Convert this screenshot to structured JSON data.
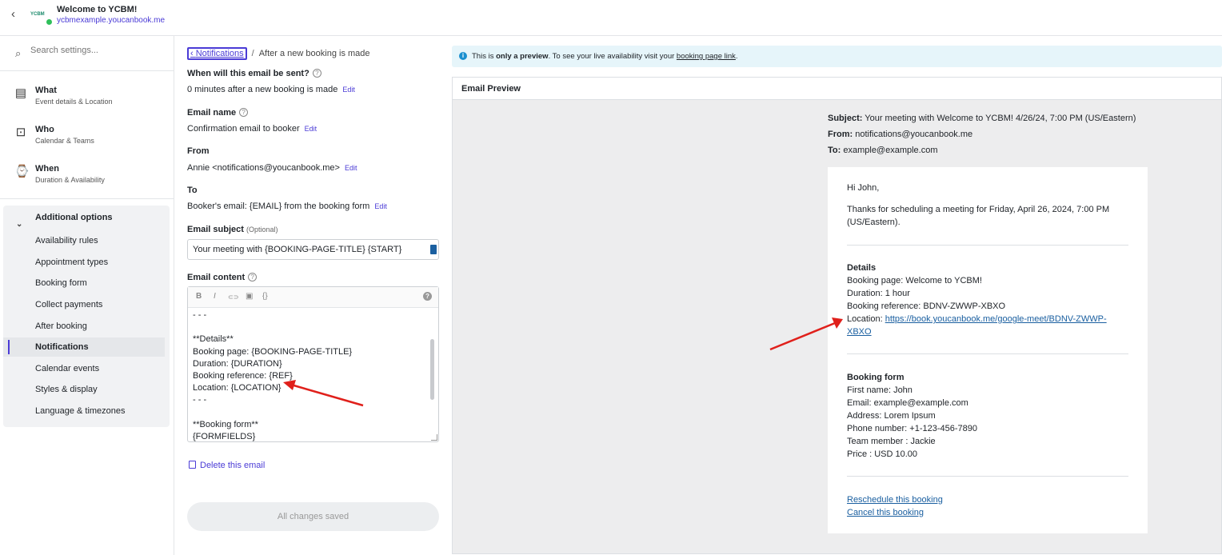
{
  "header": {
    "back_icon": "chevron-left-icon",
    "title": "Welcome to YCBM!",
    "subtitle": "ycbmexample.youcanbook.me",
    "logo_text": "YCBM"
  },
  "sidebar": {
    "search_placeholder": "Search settings...",
    "main_items": [
      {
        "label": "What",
        "sub": "Event details & Location",
        "icon": "document-icon"
      },
      {
        "label": "Who",
        "sub": "Calendar & Teams",
        "icon": "team-icon"
      },
      {
        "label": "When",
        "sub": "Duration & Availability",
        "icon": "watch-icon"
      }
    ],
    "additional_header": "Additional options",
    "additional_items": [
      "Availability rules",
      "Appointment types",
      "Booking form",
      "Collect payments",
      "After booking",
      "Notifications",
      "Calendar events",
      "Styles & display",
      "Language & timezones"
    ],
    "active_item": "Notifications"
  },
  "form": {
    "breadcrumb_link": "Notifications",
    "breadcrumb_sep": "/",
    "breadcrumb_current": "After a new booking is made",
    "when_label": "When will this email be sent?",
    "when_value": "0 minutes after a new booking is made",
    "name_label": "Email name",
    "name_value": "Confirmation email to booker",
    "from_label": "From",
    "from_value": "Annie <notifications@youcanbook.me>",
    "to_label": "To",
    "to_value": "Booker's email: {EMAIL} from the booking form",
    "edit_label": "Edit",
    "subject_label": "Email subject",
    "subject_optional": "(Optional)",
    "subject_value": "Your meeting with {BOOKING-PAGE-TITLE} {START}",
    "content_label": "Email content",
    "toolbar": {
      "bold": "B",
      "italic": "I",
      "link": "⊂⊃",
      "image": "▣",
      "code": "{}",
      "help": "?"
    },
    "content_body": "- - -\n\n**Details**\nBooking page: {BOOKING-PAGE-TITLE}\nDuration: {DURATION}\nBooking reference: {REF}\nLocation: {LOCATION}\n- - -\n\n**Booking form**\n{FORMFIELDS}",
    "delete_label": "Delete this email",
    "save_label": "All changes saved"
  },
  "info_bar": {
    "prefix": "This is ",
    "bold": "only a preview",
    "middle": ". To see your live availability visit your ",
    "link": "booking page link",
    "suffix": "."
  },
  "preview": {
    "title": "Email Preview",
    "subject_key": "Subject:",
    "subject_val": " Your meeting with Welcome to YCBM! 4/26/24, 7:00 PM (US/Eastern)",
    "from_key": "From:",
    "from_val": " notifications@youcanbook.me",
    "to_key": "To:",
    "to_val": " example@example.com",
    "greeting": "Hi John,",
    "thanks_line1": "Thanks for scheduling a meeting for Friday, April 26, 2024, 7:00 PM",
    "thanks_line2": "(US/Eastern).",
    "details_title": "Details",
    "details": [
      "Booking page: Welcome to YCBM!",
      "Duration: 1 hour",
      "Booking reference: BDNV-ZWWP-XBXO"
    ],
    "location_key": "Location: ",
    "location_link1": "https://book.youcanbook.me/google-meet/BDNV-ZWWP-",
    "location_link2": "XBXO",
    "form_title": "Booking form",
    "form_fields": [
      "First name: John",
      "Email: example@example.com",
      "Address: Lorem Ipsum",
      "Phone number: +1-123-456-7890",
      "Team member : Jackie",
      "Price : USD 10.00"
    ],
    "reschedule": "Reschedule this booking",
    "cancel": "Cancel this booking"
  },
  "colors": {
    "accent": "#4a3bd6",
    "arrow": "#e0201b",
    "link": "#1a5fa0"
  }
}
